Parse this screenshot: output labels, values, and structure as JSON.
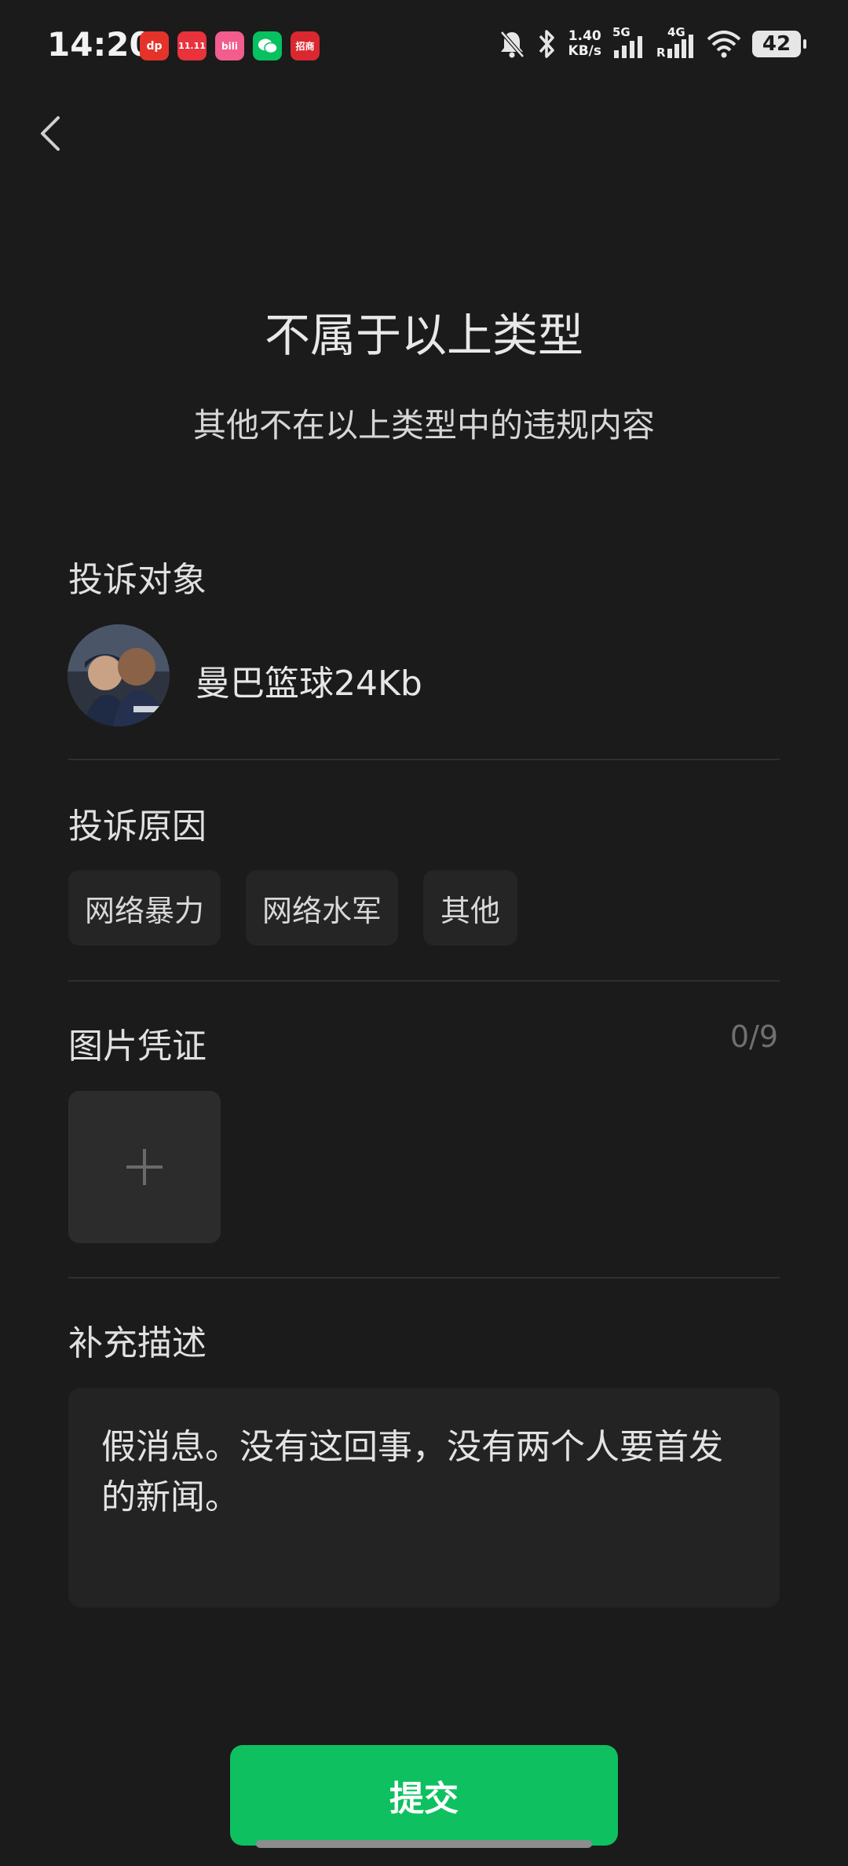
{
  "status_bar": {
    "time": "14:20",
    "net_speed_value": "1.40",
    "net_speed_unit": "KB/s",
    "sim1": "5G",
    "sim2": "4G",
    "sim2_roaming": "R",
    "battery": "42",
    "app_icons": [
      {
        "name": "dianping-icon",
        "label": "dp",
        "color": "#e5332a"
      },
      {
        "name": "tmall-1111-icon",
        "label": "11.11",
        "color": "#e8323c"
      },
      {
        "name": "bilibili-icon",
        "label": "bili",
        "color": "#f25d8e"
      },
      {
        "name": "wechat-icon",
        "label": "",
        "color": "#07c160"
      },
      {
        "name": "cmb-securities-icon",
        "label": "招商",
        "color": "#d9282f"
      }
    ]
  },
  "header": {
    "title": "不属于以上类型",
    "subtitle": "其他不在以上类型中的违规内容"
  },
  "target": {
    "label": "投诉对象",
    "name": "曼巴篮球24Kb"
  },
  "reason": {
    "label": "投诉原因",
    "chips": [
      "网络暴力",
      "网络水军",
      "其他"
    ]
  },
  "photos": {
    "label": "图片凭证",
    "count": "0/9"
  },
  "description": {
    "label": "补充描述",
    "text": "假消息。没有这回事，没有两个人要首发的新闻。"
  },
  "submit_label": "提交",
  "colors": {
    "background": "#1b1b1b",
    "accent": "#0fc060"
  }
}
